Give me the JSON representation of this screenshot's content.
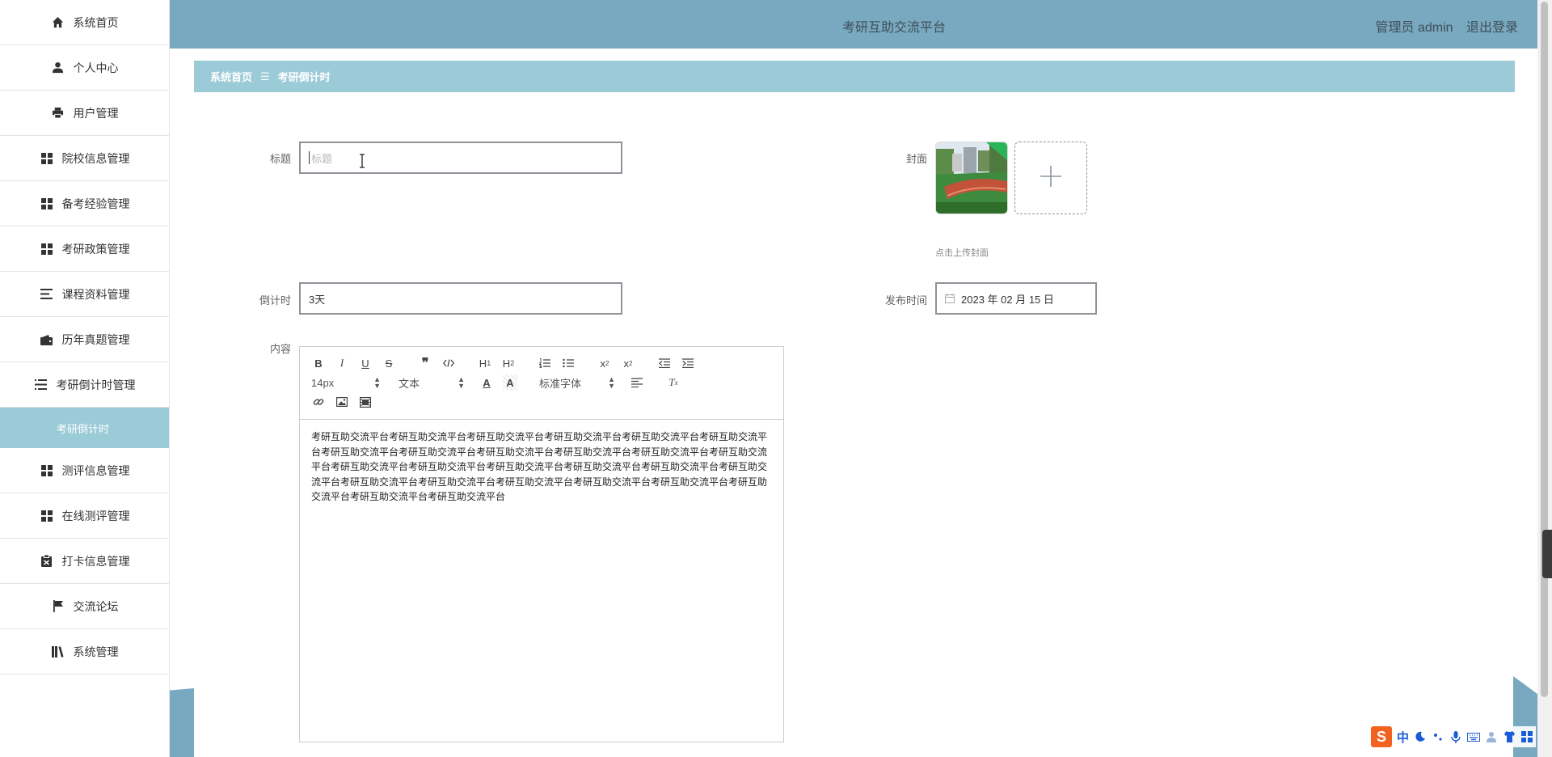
{
  "app": {
    "title": "考研互助交流平台",
    "user_label": "管理员 admin",
    "logout_label": "退出登录"
  },
  "sidebar": {
    "items": [
      {
        "label": "系统首页",
        "icon": "home-icon"
      },
      {
        "label": "个人中心",
        "icon": "user-icon"
      },
      {
        "label": "用户管理",
        "icon": "printer-icon"
      },
      {
        "label": "院校信息管理",
        "icon": "grid-icon"
      },
      {
        "label": "备考经验管理",
        "icon": "grid-icon"
      },
      {
        "label": "考研政策管理",
        "icon": "grid-icon"
      },
      {
        "label": "课程资料管理",
        "icon": "list-icon"
      },
      {
        "label": "历年真题管理",
        "icon": "wallet-icon"
      },
      {
        "label": "考研倒计时管理",
        "icon": "outdent-icon"
      },
      {
        "label": "考研倒计时",
        "icon": "",
        "sub": true
      },
      {
        "label": "测评信息管理",
        "icon": "grid-icon"
      },
      {
        "label": "在线测评管理",
        "icon": "grid-icon"
      },
      {
        "label": "打卡信息管理",
        "icon": "clipboard-icon"
      },
      {
        "label": "交流论坛",
        "icon": "flag-icon"
      },
      {
        "label": "系统管理",
        "icon": "library-icon"
      }
    ]
  },
  "breadcrumb": {
    "home": "系统首页",
    "separator": "☰",
    "current": "考研倒计时"
  },
  "form": {
    "title_label": "标题",
    "title_placeholder": "标题",
    "title_value": "",
    "cover_label": "封面",
    "upload_tip": "点击上传封面",
    "countdown_label": "倒计时",
    "countdown_value": "3天",
    "publish_label": "发布时间",
    "publish_value": "2023 年 02 月 15 日",
    "content_label": "内容"
  },
  "editor": {
    "font_size": "14px",
    "text_style": "文本",
    "font_family": "标准字体",
    "content": "考研互助交流平台考研互助交流平台考研互助交流平台考研互助交流平台考研互助交流平台考研互助交流平台考研互助交流平台考研互助交流平台考研互助交流平台考研互助交流平台考研互助交流平台考研互助交流平台考研互助交流平台考研互助交流平台考研互助交流平台考研互助交流平台考研互助交流平台考研互助交流平台考研互助交流平台考研互助交流平台考研互助交流平台考研互助交流平台考研互助交流平台考研互助交流平台考研互助交流平台考研互助交流平台"
  },
  "ime": {
    "logo": "S",
    "mode": "中"
  },
  "colors": {
    "header": "#78a9c0",
    "accent": "#9ccbd8"
  }
}
